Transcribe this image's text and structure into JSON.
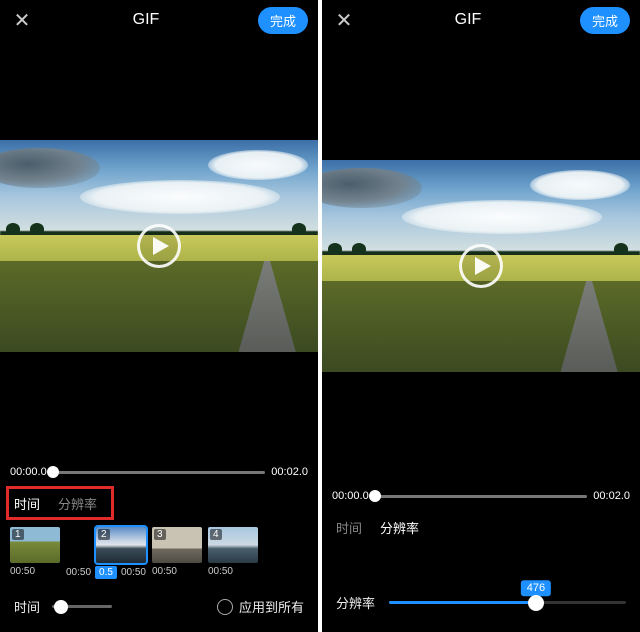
{
  "left": {
    "header": {
      "title": "GIF",
      "done": "完成"
    },
    "preview_spacer_h": 100,
    "timeline": {
      "start": "00:00.0",
      "end": "00:02.0"
    },
    "tabs": {
      "time": "时间",
      "resolution": "分辨率",
      "active": "time"
    },
    "thumbs": [
      {
        "index": "1",
        "duration": "00:50",
        "scene": "scene-field"
      },
      {
        "index": "2",
        "duration": "00:50",
        "pill": "0.5",
        "scene": "scene-mtn",
        "selected": true
      },
      {
        "index": "3",
        "duration": "00:50",
        "scene": "scene-build"
      },
      {
        "index": "4",
        "duration": "00:50",
        "scene": "scene-mtn2"
      }
    ],
    "bottom": {
      "label": "时间",
      "apply_all": "应用到所有"
    }
  },
  "right": {
    "header": {
      "title": "GIF",
      "done": "完成"
    },
    "preview_spacer_h": 120,
    "timeline": {
      "start": "00:00.0",
      "end": "00:02.0"
    },
    "tabs": {
      "time": "时间",
      "resolution": "分辨率",
      "active": "resolution"
    },
    "resolution": {
      "label": "分辨率",
      "value": "476",
      "percent": 62
    }
  }
}
